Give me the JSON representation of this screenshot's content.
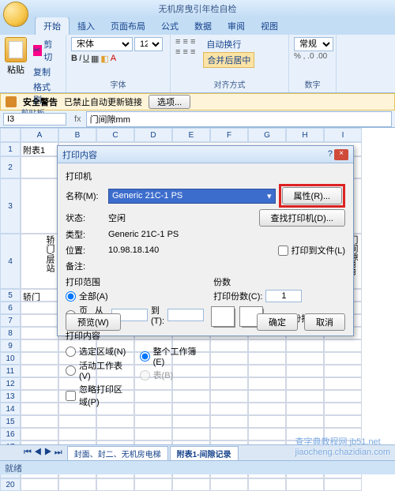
{
  "window": {
    "title": "无机房曳引年检自检"
  },
  "menubar": [
    "-",
    "□",
    "×"
  ],
  "tabs": [
    "开始",
    "插入",
    "页面布局",
    "公式",
    "数据",
    "审阅",
    "视图"
  ],
  "ribbon": {
    "clipboard": {
      "label": "剪贴板",
      "paste": "粘贴",
      "cut": "剪切",
      "copy": "复制",
      "format": "格式刷"
    },
    "font": {
      "label": "字体",
      "name": "宋体",
      "size": "12"
    },
    "align": {
      "label": "对齐方式",
      "wrap": "自动换行",
      "merge": "合并后居中"
    },
    "number": {
      "label": "数字",
      "format": "常规"
    }
  },
  "warn": {
    "label": "安全警告",
    "msg": "已禁止自动更新链接",
    "opt": "选项..."
  },
  "namebox": "I3",
  "fx_value": "门间隙mm",
  "cols": [
    "A",
    "B",
    "C",
    "D",
    "E",
    "F",
    "G",
    "H",
    "I"
  ],
  "rows": [
    "1",
    "2",
    "3",
    "4",
    "5",
    "6",
    "7",
    "8",
    "9",
    "10",
    "11",
    "12",
    "13",
    "14",
    "15",
    "16",
    "17",
    "18",
    "19",
    "20"
  ],
  "cells": {
    "a1": "附表1",
    "a4": "轿门/层站",
    "a5": "轿门",
    "i4": "门间隙mm"
  },
  "dialog": {
    "title": "打印内容",
    "printer": {
      "head": "打印机",
      "name_l": "名称(M):",
      "name_v": "Generic 21C-1 PS",
      "status_l": "状态:",
      "status_v": "空闲",
      "type_l": "类型:",
      "type_v": "Generic 21C-1 PS",
      "where_l": "位置:",
      "where_v": "10.98.18.140",
      "comment_l": "备注:"
    },
    "btn_prop": "属性(R)...",
    "btn_find": "查找打印机(D)...",
    "chk_file": "打印到文件(L)",
    "range": {
      "head": "打印范围",
      "all": "全部(A)",
      "pages": "页(G)",
      "from": "从(F):",
      "to": "到(T):"
    },
    "copies": {
      "head": "份数",
      "label": "打印份数(C):",
      "val": "1",
      "collate": "逐份打印(O)"
    },
    "content": {
      "head": "打印内容",
      "sel": "选定区域(N)",
      "whole": "整个工作簿(E)",
      "active": "活动工作表(V)",
      "table": "表(B)",
      "ignore": "忽略打印区域(P)"
    },
    "preview": "预览(W)",
    "ok": "确定",
    "cancel": "取消"
  },
  "sheets": [
    "封面、封二、无机房电梯",
    "附表1-间隙记录"
  ],
  "status": "就绪",
  "watermark": "jiaocheng.chazidian.com",
  "wm2": "查字典教程网 jb51.net"
}
